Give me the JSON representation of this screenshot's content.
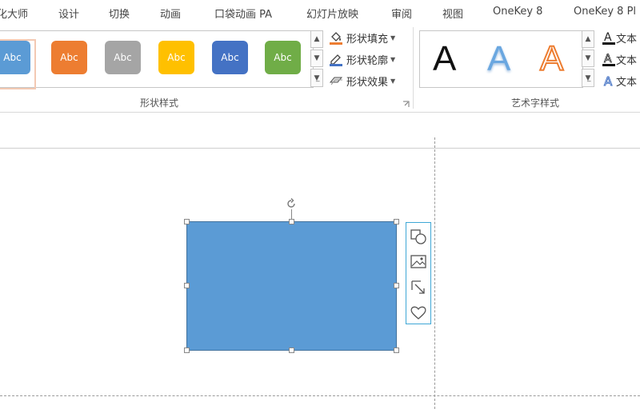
{
  "menu": {
    "tabs": [
      "化大师",
      "设计",
      "切换",
      "动画",
      "口袋动画 PA",
      "幻灯片放映",
      "审阅",
      "视图",
      "OneKey 8",
      "OneKey 8 Pl"
    ]
  },
  "ribbon": {
    "shape_styles": {
      "group_label": "形状样式",
      "swatches": [
        {
          "label": "Abc",
          "color": "#5b9bd5"
        },
        {
          "label": "Abc",
          "color": "#ed7d31"
        },
        {
          "label": "Abc",
          "color": "#a5a5a5"
        },
        {
          "label": "Abc",
          "color": "#ffc000"
        },
        {
          "label": "Abc",
          "color": "#4472c4"
        },
        {
          "label": "Abc",
          "color": "#70ad47"
        }
      ],
      "fill_label": "形状填充",
      "outline_label": "形状轮廓",
      "effects_label": "形状效果"
    },
    "wordart_styles": {
      "group_label": "艺术字样式",
      "samples": [
        "A",
        "A",
        "A"
      ],
      "text_fill_label": "文本",
      "text_outline_label": "文本",
      "text_effects_label": "文本"
    }
  },
  "colors": {
    "accent_selection": "#f3c9b3",
    "shape_fill": "#5b9bd5",
    "shape_border": "#41719c",
    "quick_toolbar_border": "#3ea7d6"
  }
}
